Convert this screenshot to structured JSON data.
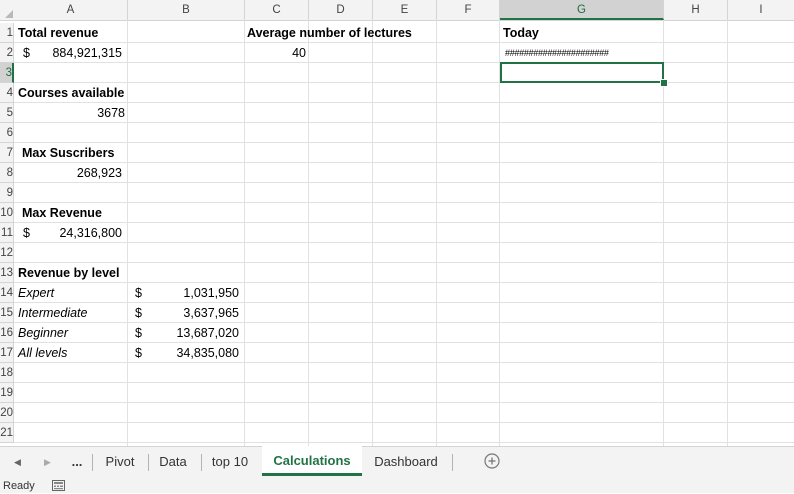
{
  "columns": [
    "A",
    "B",
    "C",
    "D",
    "E",
    "F",
    "G",
    "H",
    "I"
  ],
  "selected_column": "G",
  "rows": [
    "1",
    "2",
    "3",
    "4",
    "5",
    "6",
    "7",
    "8",
    "9",
    "10",
    "11",
    "12",
    "13",
    "14",
    "15",
    "16",
    "17",
    "18",
    "19",
    "20",
    "21"
  ],
  "selected_row": "3",
  "cells": {
    "a1": "Total revenue",
    "a2_currency": "$",
    "a2_value": "884,921,315",
    "a4": "Courses available",
    "a5": "3678",
    "a7": "Max Suscribers",
    "a8": "268,923",
    "a10": "Max Revenue",
    "a11_currency": "$",
    "a11_value": "24,316,800",
    "a13": "Revenue by level",
    "levels": [
      {
        "label": "Expert",
        "currency": "$",
        "value": "1,031,950"
      },
      {
        "label": "Intermediate",
        "currency": "$",
        "value": "3,637,965"
      },
      {
        "label": "Beginner",
        "currency": "$",
        "value": "13,687,020"
      },
      {
        "label": "All levels",
        "currency": "$",
        "value": "34,835,080"
      }
    ],
    "c1": "Average number of lectures",
    "c2": "40",
    "g1": "Today",
    "g2": "######################"
  },
  "sheet_tabs": {
    "more": "...",
    "tabs": [
      "Pivot",
      "Data",
      "top 10",
      "Calculations",
      "Dashboard"
    ],
    "active": "Calculations",
    "add_icon": "plus-circle-icon"
  },
  "status": {
    "mode": "Ready",
    "macro_icon": "macro-record-icon"
  },
  "colors": {
    "accent": "#217346",
    "gridline": "#e1e1e1",
    "header_bg": "#f3f3f3"
  }
}
